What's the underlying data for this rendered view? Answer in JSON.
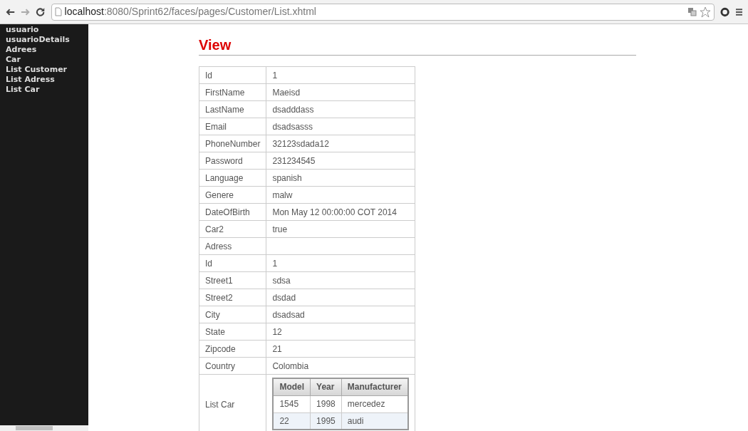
{
  "browser": {
    "url_host": "localhost",
    "url_path": ":8080/Sprint62/faces/pages/Customer/List.xhtml"
  },
  "sidebar": {
    "items": [
      {
        "label": "usuario"
      },
      {
        "label": "usuarioDetails"
      },
      {
        "label": "Adrees"
      },
      {
        "label": "Car"
      },
      {
        "label": "List Customer"
      },
      {
        "label": "List Adress"
      },
      {
        "label": "List Car"
      }
    ]
  },
  "heading": "View",
  "rows": [
    {
      "label": "Id",
      "value": "1"
    },
    {
      "label": "FirstName",
      "value": "Maeisd"
    },
    {
      "label": "LastName",
      "value": "dsadddass"
    },
    {
      "label": "Email",
      "value": "dsadsasss"
    },
    {
      "label": "PhoneNumber",
      "value": "32123sdada12"
    },
    {
      "label": "Password",
      "value": "231234545"
    },
    {
      "label": "Language",
      "value": "spanish"
    },
    {
      "label": "Genere",
      "value": "malw"
    },
    {
      "label": "DateOfBirth",
      "value": "Mon May 12 00:00:00 COT 2014"
    },
    {
      "label": "Car2",
      "value": "true"
    },
    {
      "label": "Adress"
    },
    {
      "label": "Id",
      "value": "1"
    },
    {
      "label": "Street1",
      "value": "sdsa"
    },
    {
      "label": "Street2",
      "value": "dsdad"
    },
    {
      "label": "City",
      "value": "dsadsad"
    },
    {
      "label": "State",
      "value": "12"
    },
    {
      "label": "Zipcode",
      "value": "21"
    },
    {
      "label": "Country",
      "value": "Colombia"
    }
  ],
  "list_car": {
    "label": "List Car",
    "columns": [
      "Model",
      "Year",
      "Manufacturer"
    ],
    "rows": [
      [
        "1545",
        "1998",
        "mercedez"
      ],
      [
        "22",
        "1995",
        "audi"
      ]
    ]
  }
}
